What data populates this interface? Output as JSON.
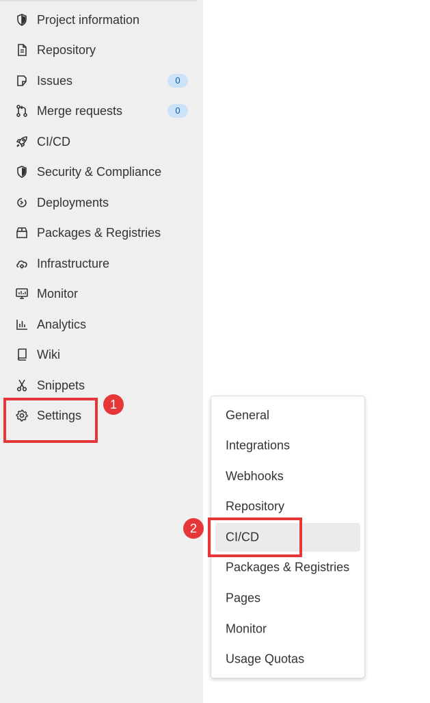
{
  "sidebar": {
    "items": [
      {
        "name": "project-information",
        "label": "Project information",
        "icon": "shield-half-icon"
      },
      {
        "name": "repository",
        "label": "Repository",
        "icon": "document-icon"
      },
      {
        "name": "issues",
        "label": "Issues",
        "icon": "issues-icon",
        "badge": "0"
      },
      {
        "name": "merge-requests",
        "label": "Merge requests",
        "icon": "merge-request-icon",
        "badge": "0"
      },
      {
        "name": "ci-cd",
        "label": "CI/CD",
        "icon": "rocket-icon"
      },
      {
        "name": "security-compliance",
        "label": "Security & Compliance",
        "icon": "shield-icon"
      },
      {
        "name": "deployments",
        "label": "Deployments",
        "icon": "deployments-icon"
      },
      {
        "name": "packages-registries",
        "label": "Packages & Registries",
        "icon": "package-icon"
      },
      {
        "name": "infrastructure",
        "label": "Infrastructure",
        "icon": "cloud-gear-icon"
      },
      {
        "name": "monitor",
        "label": "Monitor",
        "icon": "monitor-icon"
      },
      {
        "name": "analytics",
        "label": "Analytics",
        "icon": "chart-icon"
      },
      {
        "name": "wiki",
        "label": "Wiki",
        "icon": "book-icon"
      },
      {
        "name": "snippets",
        "label": "Snippets",
        "icon": "scissors-icon"
      },
      {
        "name": "settings",
        "label": "Settings",
        "icon": "gear-icon"
      }
    ]
  },
  "settings_menu": {
    "items": [
      {
        "label": "General"
      },
      {
        "label": "Integrations"
      },
      {
        "label": "Webhooks"
      },
      {
        "label": "Repository"
      },
      {
        "label": "CI/CD",
        "active": true
      },
      {
        "label": "Packages & Registries"
      },
      {
        "label": "Pages"
      },
      {
        "label": "Monitor"
      },
      {
        "label": "Usage Quotas"
      }
    ]
  },
  "annotations": {
    "step1": "1",
    "step2": "2",
    "color": "#e5363a"
  }
}
